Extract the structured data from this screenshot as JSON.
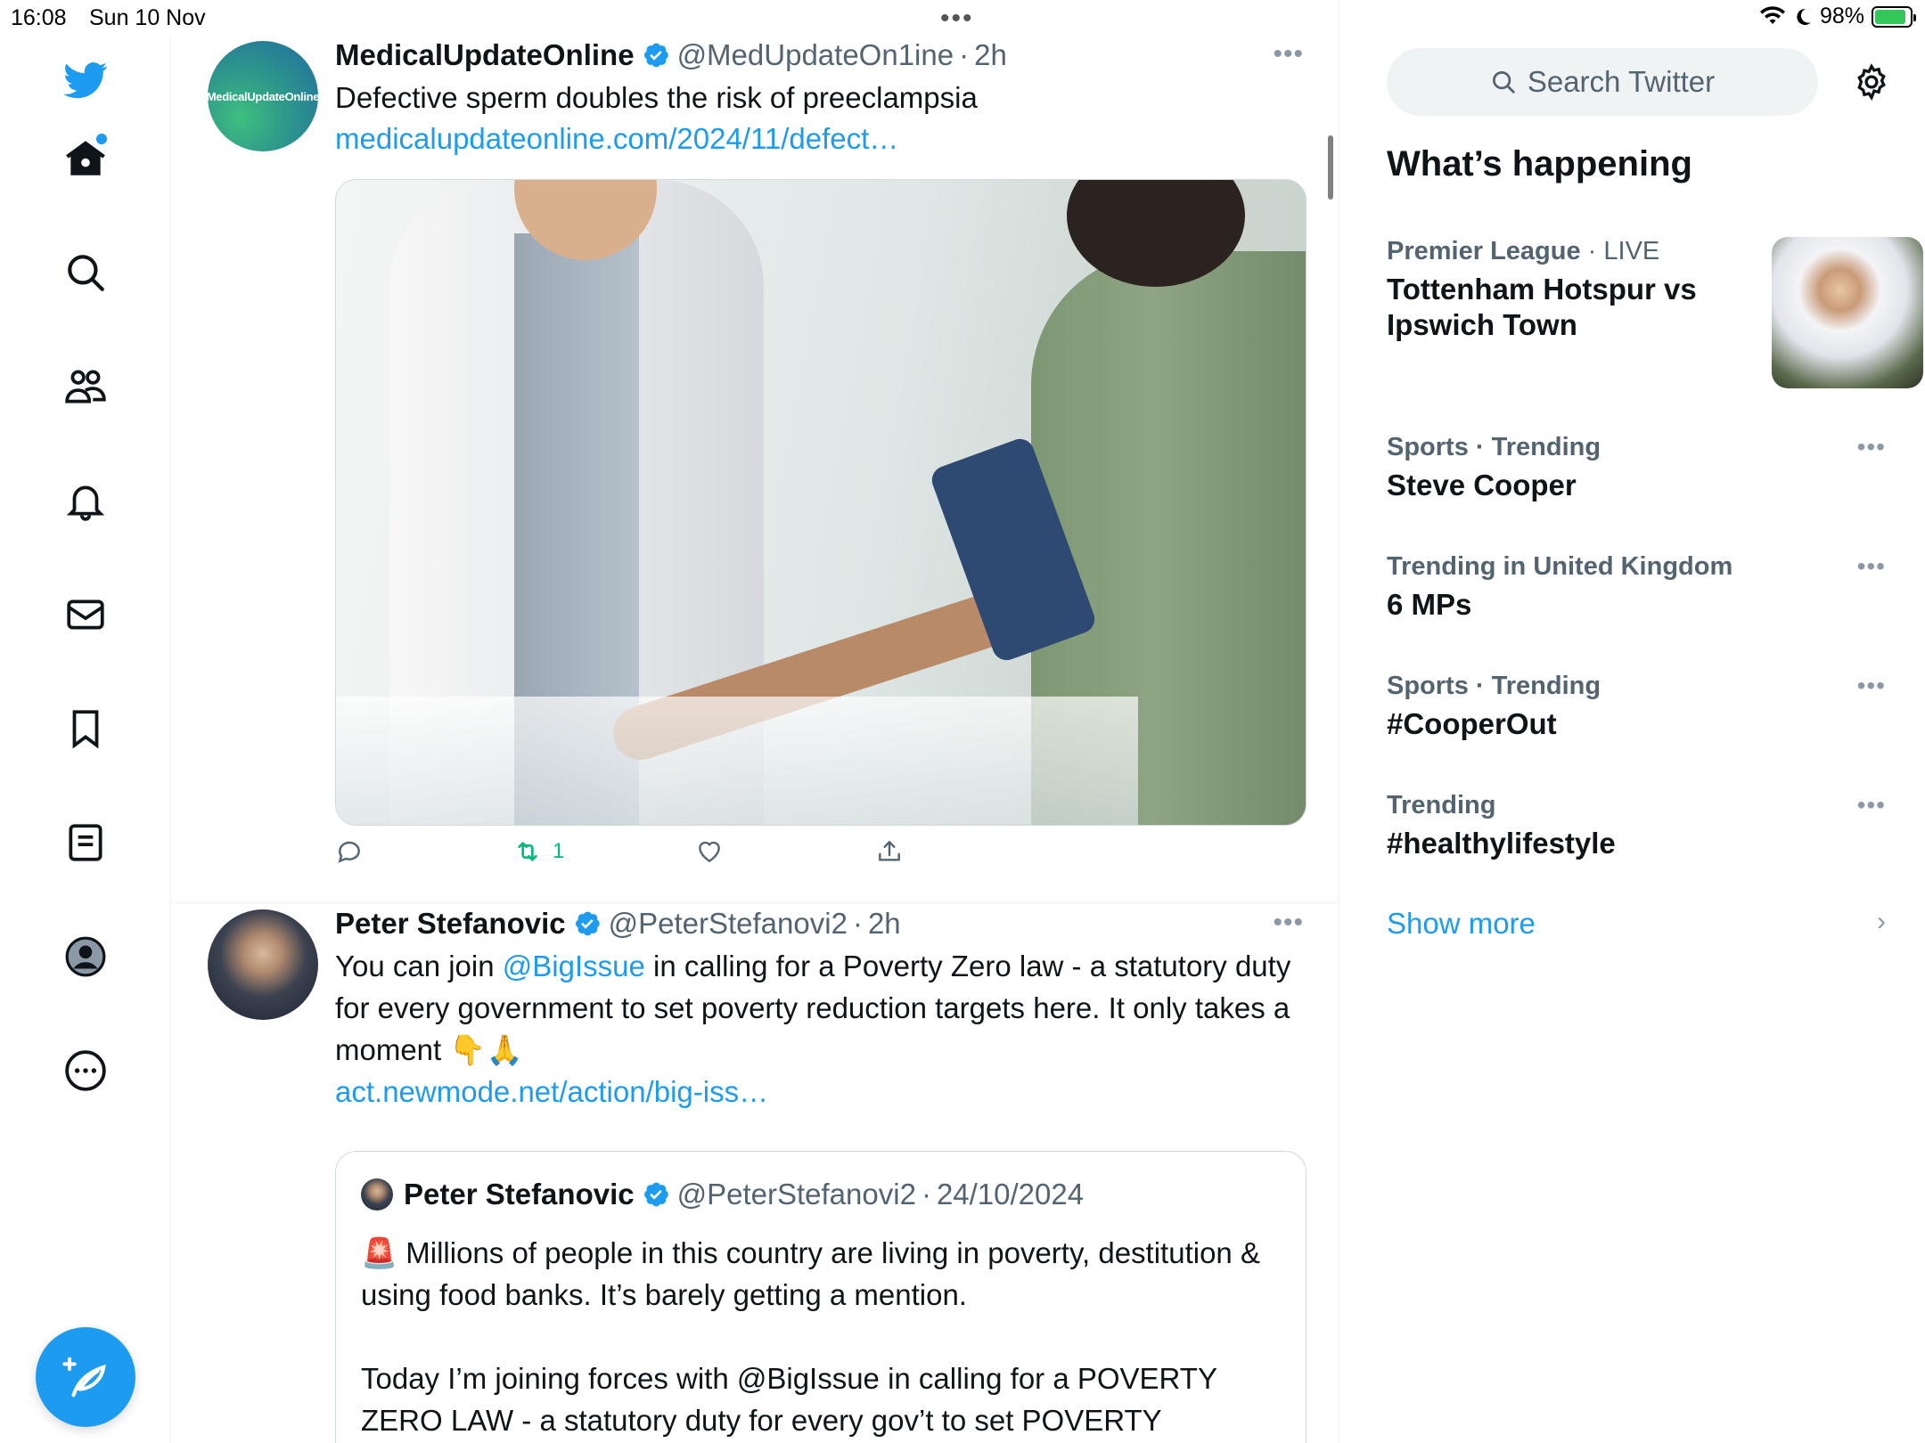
{
  "status": {
    "time": "16:08",
    "date": "Sun 10 Nov",
    "battery": "98%",
    "dots": "•••"
  },
  "nav": {
    "items": [
      "twitter-logo",
      "home",
      "explore",
      "communities",
      "notifications",
      "messages",
      "bookmarks",
      "lists",
      "profile",
      "more"
    ]
  },
  "tweets": [
    {
      "name": "MedicalUpdateOnline",
      "handle": "@MedUpdateOn1ine",
      "time": "2h",
      "avatar_text": "MedicalUpdateOnline",
      "text": "Defective sperm doubles the risk of preeclampsia",
      "link": "medicalupdateonline.com/2024/11/defect…",
      "retweets": "1",
      "more": "•••"
    },
    {
      "name": "Peter Stefanovic",
      "handle": "@PeterStefanovi2",
      "time": "2h",
      "text_before": "You can join ",
      "mention": "@BigIssue",
      "text_after": " in calling for a Poverty Zero law - a statutory duty for every government to set poverty reduction targets here. It only takes a moment 👇🙏",
      "link": "act.newmode.net/action/big-iss…",
      "more": "•••",
      "quote": {
        "name": "Peter Stefanovic",
        "handle": "@PeterStefanovi2",
        "date": "24/10/2024",
        "text": "🚨 Millions of people in this country are living in poverty, destitution & using food banks. It’s barely getting a mention.\n\nToday I’m joining forces with @BigIssue in calling for a POVERTY ZERO LAW - a statutory duty for every gov’t to set POVERTY REDUCTION TARGETS"
      }
    }
  ],
  "sidebar": {
    "search_placeholder": "Search Twitter",
    "title": "What’s happening",
    "trends": [
      {
        "context": "Premier League",
        "live": "LIVE",
        "title": "Tottenham Hotspur vs Ipswich Town"
      },
      {
        "context": "Sports · Trending",
        "title": "Steve Cooper"
      },
      {
        "context": "Trending in United Kingdom",
        "title": "6 MPs"
      },
      {
        "context": "Sports · Trending",
        "title": "#CooperOut"
      },
      {
        "context": "Trending",
        "title": "#healthylifestyle"
      }
    ],
    "show_more": "Show more",
    "more": "•••"
  },
  "colors": {
    "accent": "#1d9bf0",
    "retweet": "#00ba7c",
    "secondary_text": "#536471"
  }
}
